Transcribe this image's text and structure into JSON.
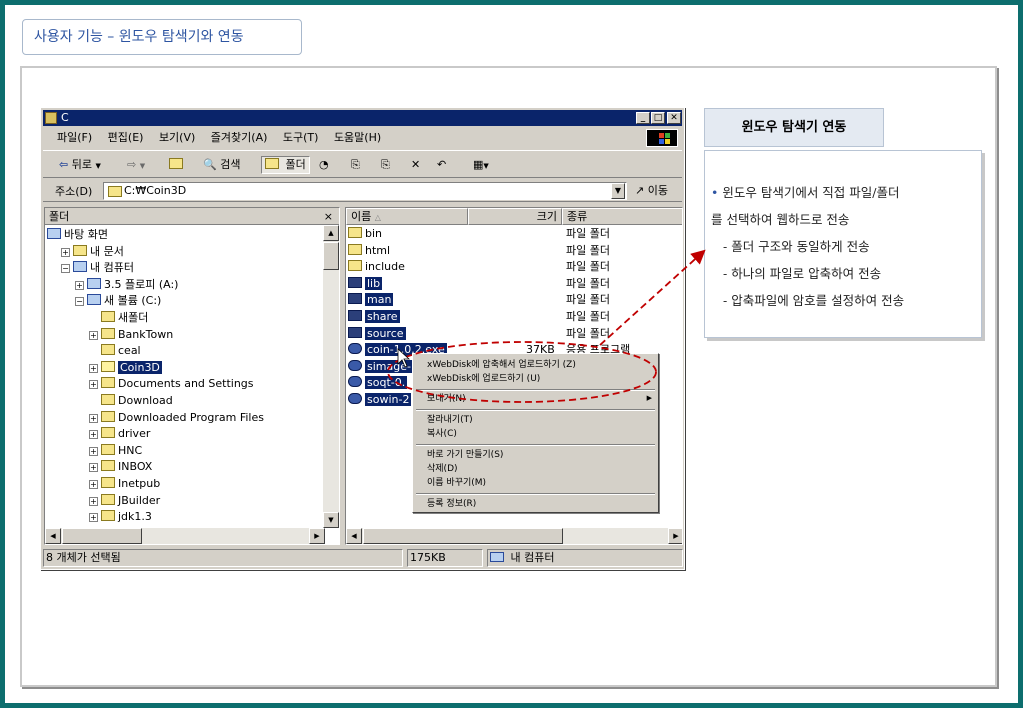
{
  "page_title": "사용자 기능 – 윈도우 탐색기와 연동",
  "window": {
    "title": "C",
    "controls": {
      "minimize": "_",
      "maximize": "□",
      "close": "✕"
    },
    "menu": [
      "파일(F)",
      "편집(E)",
      "보기(V)",
      "즐겨찾기(A)",
      "도구(T)",
      "도움말(H)"
    ],
    "toolbar": {
      "back": "뒤로",
      "search": "검색",
      "folders": "폴더"
    },
    "address": {
      "label": "주소(D)",
      "value": "C:₩Coin3D",
      "go": "이동"
    },
    "folder_pane": {
      "header": "폴더",
      "close": "×",
      "tree": [
        {
          "label": "바탕 화면",
          "depth": 0,
          "expander": "",
          "icon": "desktop-icon"
        },
        {
          "label": "내 문서",
          "depth": 1,
          "expander": "+",
          "icon": "my-documents-icon"
        },
        {
          "label": "내 컴퓨터",
          "depth": 1,
          "expander": "−",
          "icon": "my-computer-icon"
        },
        {
          "label": "3.5 플로피 (A:)",
          "depth": 2,
          "expander": "+",
          "icon": "floppy-icon"
        },
        {
          "label": "새 볼륨 (C:)",
          "depth": 2,
          "expander": "−",
          "icon": "drive-icon"
        },
        {
          "label": "새폴더",
          "depth": 3,
          "expander": "",
          "icon": "folder-icon"
        },
        {
          "label": "BankTown",
          "depth": 3,
          "expander": "+",
          "icon": "folder-icon"
        },
        {
          "label": "ceal",
          "depth": 3,
          "expander": "",
          "icon": "folder-icon"
        },
        {
          "label": "Coin3D",
          "depth": 3,
          "expander": "+",
          "icon": "open-folder-icon",
          "selected": true
        },
        {
          "label": "Documents and Settings",
          "depth": 3,
          "expander": "+",
          "icon": "folder-icon"
        },
        {
          "label": "Download",
          "depth": 3,
          "expander": "",
          "icon": "folder-icon"
        },
        {
          "label": "Downloaded Program Files",
          "depth": 3,
          "expander": "+",
          "icon": "folder-icon"
        },
        {
          "label": "driver",
          "depth": 3,
          "expander": "+",
          "icon": "folder-icon"
        },
        {
          "label": "HNC",
          "depth": 3,
          "expander": "+",
          "icon": "folder-icon"
        },
        {
          "label": "INBOX",
          "depth": 3,
          "expander": "+",
          "icon": "folder-icon"
        },
        {
          "label": "Inetpub",
          "depth": 3,
          "expander": "+",
          "icon": "folder-icon"
        },
        {
          "label": "JBuilder",
          "depth": 3,
          "expander": "+",
          "icon": "folder-icon"
        },
        {
          "label": "jdk1.3",
          "depth": 3,
          "expander": "+",
          "icon": "folder-icon"
        }
      ]
    },
    "file_pane": {
      "columns": [
        "이름",
        "크기",
        "종류"
      ],
      "files": [
        {
          "name": "bin",
          "size": "",
          "type": "파일 폴더",
          "selected": false,
          "kind": "folder"
        },
        {
          "name": "html",
          "size": "",
          "type": "파일 폴더",
          "selected": false,
          "kind": "folder"
        },
        {
          "name": "include",
          "size": "",
          "type": "파일 폴더",
          "selected": false,
          "kind": "folder"
        },
        {
          "name": "lib",
          "size": "",
          "type": "파일 폴더",
          "selected": true,
          "kind": "folder"
        },
        {
          "name": "man",
          "size": "",
          "type": "파일 폴더",
          "selected": true,
          "kind": "folder"
        },
        {
          "name": "share",
          "size": "",
          "type": "파일 폴더",
          "selected": true,
          "kind": "folder"
        },
        {
          "name": "source",
          "size": "",
          "type": "파일 폴더",
          "selected": true,
          "kind": "folder"
        },
        {
          "name": "coin-1.0.2.exe",
          "size": "37KB",
          "type": "응용 프로그램",
          "selected": true,
          "kind": "exe"
        },
        {
          "name": "simage-",
          "size": "",
          "type": "",
          "selected": true,
          "kind": "exe"
        },
        {
          "name": "soqt-0.",
          "size": "",
          "type": "",
          "selected": true,
          "kind": "exe"
        },
        {
          "name": "sowin-2",
          "size": "",
          "type": "",
          "selected": true,
          "kind": "exe"
        }
      ]
    },
    "status": {
      "count": "8 개체가 선택됨",
      "size": "175KB",
      "location": "내 컴퓨터"
    }
  },
  "context_menu": {
    "items": [
      {
        "label": "xWebDisk에 압축해서 업로드하기 (Z)",
        "group": 1
      },
      {
        "label": "xWebDisk에 업로드하기 (U)",
        "group": 1
      },
      {
        "label": "보내기(N)",
        "group": 2,
        "submenu": true
      },
      {
        "label": "잘라내기(T)",
        "group": 3
      },
      {
        "label": "복사(C)",
        "group": 3
      },
      {
        "label": "바로 가기 만들기(S)",
        "group": 4
      },
      {
        "label": "삭제(D)",
        "group": 4
      },
      {
        "label": "이름 바꾸기(M)",
        "group": 4
      },
      {
        "label": "등록 정보(R)",
        "group": 5
      }
    ]
  },
  "side_panel": {
    "title": "윈도우 탐색기 연동",
    "bullet": "•",
    "line1": "윈도우 탐색기에서 직접 파일/폴더",
    "line2": "를 선택하여 웹하드로 전송",
    "sub_items": [
      "- 폴더 구조와 동일하게 전송",
      "- 하나의 파일로 압축하여 전송",
      "- 압축파일에 암호를 설정하여 전송"
    ]
  },
  "colors": {
    "accent": "#2e55a2",
    "selection": "#0a246a",
    "annotation": "#c00000",
    "frame": "#0d6e6e"
  }
}
